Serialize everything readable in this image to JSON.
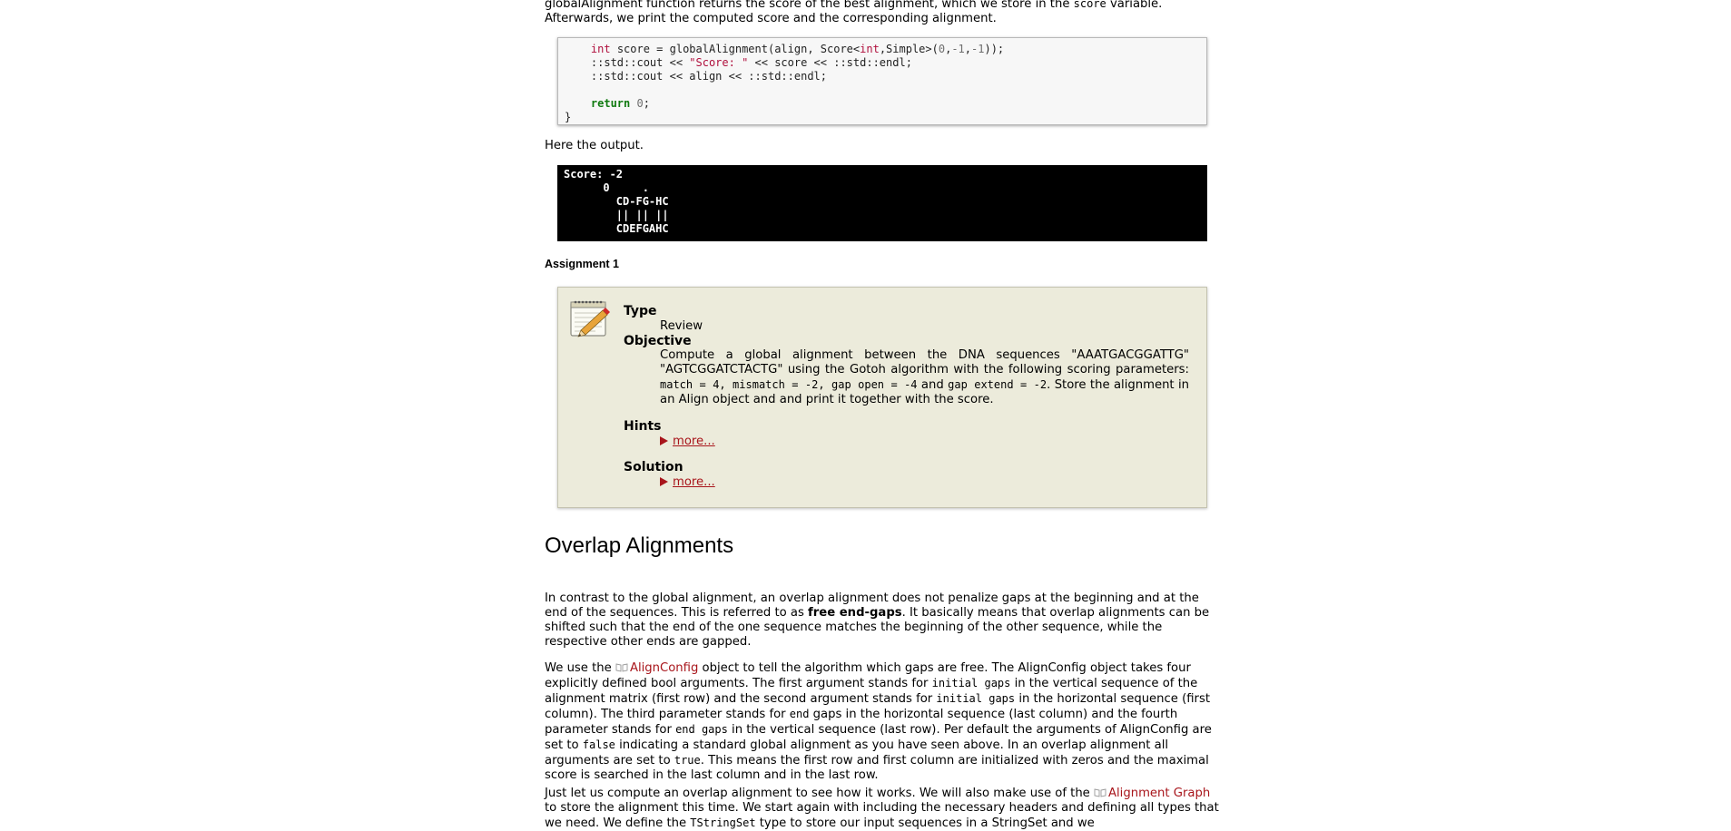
{
  "intro": {
    "line1_pre": "globalAlignment function returns the score of the best alignment, which we store in the ",
    "line1_code": "score",
    "line1_post": " variable.",
    "line2": "Afterwards, we print the computed score and the corresponding alignment."
  },
  "code": {
    "l1_kw": "int",
    "l1_a": " score = globalAlignment(align, Score<",
    "l1_kw2": "int",
    "l1_b": ",Simple>(",
    "l1_n1": "0",
    "l1_c": ",",
    "l1_n2": "-1",
    "l1_d": ",",
    "l1_n3": "-1",
    "l1_e": "));",
    "l2_a": "::std::cout << ",
    "l2_str": "\"Score: \"",
    "l2_b": " << score << ::std::endl;",
    "l3": "::std::cout << align << ::std::endl;",
    "l5_ret": "return",
    "l5_num": "0",
    "l5_end": ";",
    "l6": "}"
  },
  "output_label": "Here the output.",
  "output": {
    "line1": "Score: -2",
    "line2": "      0     .",
    "line3": "        CD-FG-HC",
    "line4": "        || || ||",
    "line5": "        CDEFGAHC"
  },
  "assignment": {
    "title": "Assignment 1",
    "type_label": "Type",
    "type_value": "Review",
    "objective_label": "Objective",
    "objective_pre": "Compute a global alignment between the DNA sequences \"AAATGACGGATTG\" \"AGTCGGATCTACTG\" using the Gotoh algorithm with the following scoring parameters: ",
    "objective_code": "match = 4, mismatch = -2, gap open = -4",
    "objective_mid": " and ",
    "objective_code2": "gap extend = -2",
    "objective_post": ". Store the alignment in an Align object and and print it together with the score.",
    "hints_label": "Hints",
    "hints_link": "more...",
    "solution_label": "Solution",
    "solution_link": "more..."
  },
  "section": {
    "title": "Overlap Alignments"
  },
  "para1": {
    "pre": "In contrast to the global alignment, an overlap alignment does not penalize gaps at the beginning and at the end of the sequences. This is referred to as ",
    "bold": "free end-gaps",
    "post": ". It basically means that overlap alignments can be shifted such that the end of the one sequence matches the beginning of the other sequence, while the respective other ends are gapped."
  },
  "para2": {
    "t1": "We use the ",
    "link": "AlignConfig",
    "t2": " object to tell the algorithm which gaps are free. The AlignConfig object takes four explicitly defined bool arguments. The first argument stands for ",
    "c1": "initial gaps",
    "t3": " in the vertical sequence of the alignment matrix (first row) and the second argument stands for ",
    "c2": "initial gaps",
    "t4": " in the horizontal sequence (first column). The third parameter stands for ",
    "c3": "end",
    "t5": " gaps in the horizontal sequence (last column) and the fourth parameter stands for ",
    "c4": "end gaps",
    "t6": " in the vertical sequence (last row). Per default the arguments of AlignConfig are set to ",
    "c5": "false",
    "t7": " indicating a standard global alignment as you have seen above. In an overlap alignment all arguments are set to ",
    "c6": "true",
    "t8": ". This means the first row and first column are initialized with zeros and the maximal score is searched in the last column and in the last row."
  },
  "para3": {
    "t1": "Just let us compute an overlap alignment to see how it works. We will also make use of the ",
    "link": "Alignment Graph",
    "t2": " to store the alignment this time. We start again with including the necessary headers and defining all types that we need. We define the ",
    "c1": "TStringSet",
    "t3": " type to store our input sequences in a StringSet and we"
  },
  "colors": {
    "link": "#a8151b",
    "assignment_bg": "#ecebdb",
    "code_bg": "#f7f7f7",
    "output_bg": "#000000"
  }
}
